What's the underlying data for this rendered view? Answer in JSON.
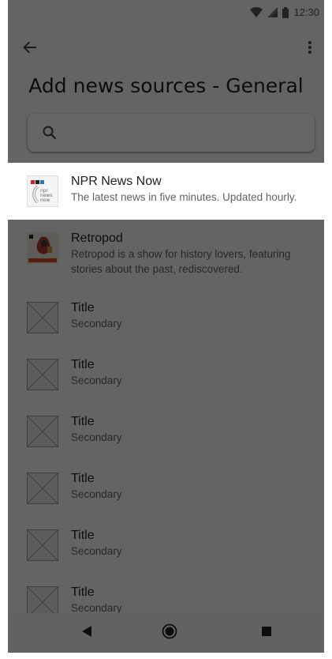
{
  "status_bar": {
    "time": "12:30",
    "icons": [
      "wifi-icon",
      "signal-icon",
      "battery-icon"
    ]
  },
  "app_bar": {
    "back_icon": "arrow-back-icon",
    "more_icon": "more-vert-icon"
  },
  "page": {
    "title": "Add news sources - General"
  },
  "search": {
    "icon": "search-icon",
    "value": "",
    "placeholder": ""
  },
  "list": {
    "items": [
      {
        "title": "NPR News Now",
        "subtitle": "The latest news in five minutes. Updated hourly.",
        "thumb": "npr-news-now-logo",
        "highlighted": true
      },
      {
        "title": "Retropod",
        "subtitle": "Retropod is a show for history lovers, featuring stories about the past, rediscovered.",
        "thumb": "retropod-logo",
        "highlighted": false
      },
      {
        "title": "Title",
        "subtitle": "Secondary",
        "thumb": "image-placeholder"
      },
      {
        "title": "Title",
        "subtitle": "Secondary",
        "thumb": "image-placeholder"
      },
      {
        "title": "Title",
        "subtitle": "Secondary",
        "thumb": "image-placeholder"
      },
      {
        "title": "Title",
        "subtitle": "Secondary",
        "thumb": "image-placeholder"
      },
      {
        "title": "Title",
        "subtitle": "Secondary",
        "thumb": "image-placeholder"
      },
      {
        "title": "Title",
        "subtitle": "Secondary",
        "thumb": "image-placeholder"
      }
    ]
  },
  "nav_bar": {
    "icons": [
      "nav-back-icon",
      "nav-home-icon",
      "nav-recents-icon"
    ]
  },
  "colors": {
    "scrim": "#000000",
    "text_primary": "#202124",
    "text_secondary": "#5f6368",
    "npr_red": "#d62021",
    "npr_blue": "#237bbd"
  }
}
